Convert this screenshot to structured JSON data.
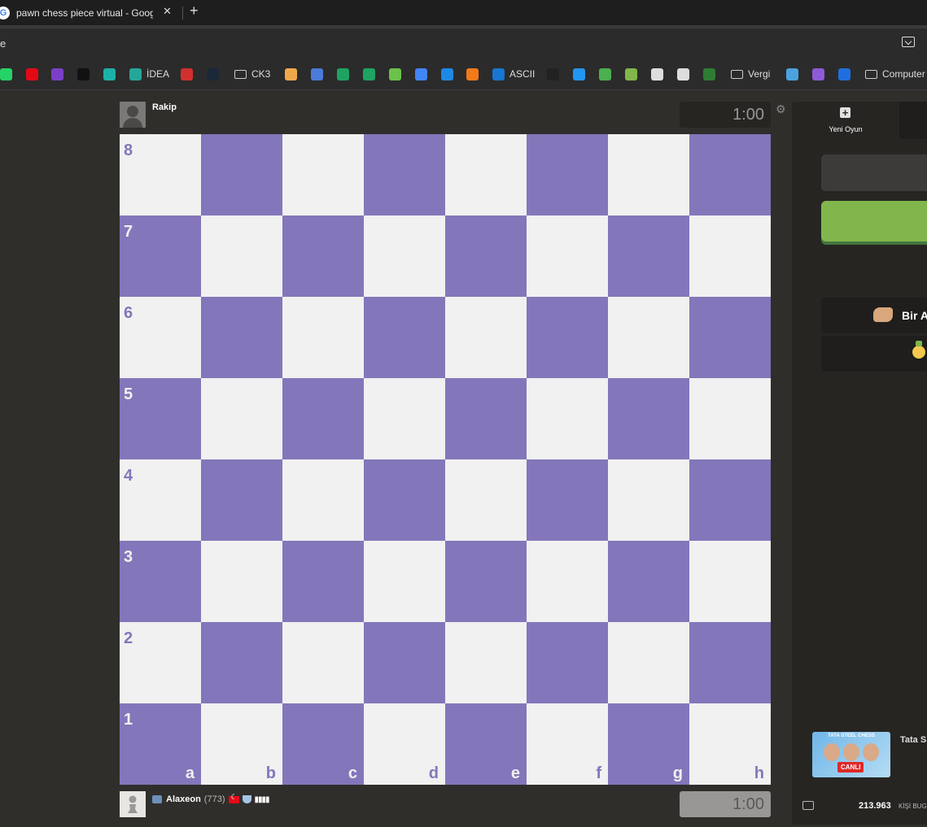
{
  "browser": {
    "tab_title": "pawn chess piece virtual - Goog",
    "tab_favicon": "G",
    "tab_close": "✕",
    "new_tab": "+",
    "address_text": "e"
  },
  "bookmarks": [
    {
      "icon": "whatsapp-icon",
      "color": "#25d366",
      "label": ""
    },
    {
      "icon": "netflix-icon",
      "color": "#e50914",
      "label": ""
    },
    {
      "icon": "bolt-icon",
      "color": "#7b3fc7",
      "label": ""
    },
    {
      "icon": "map-pin-icon",
      "color": "#111111",
      "label": ""
    },
    {
      "icon": "spiral-icon",
      "color": "#1bb1a8",
      "label": ""
    },
    {
      "icon": "idea-icon",
      "color": "#26a69a",
      "label": "İDEA"
    },
    {
      "icon": "chevron-up-icon",
      "color": "#d32f2f",
      "label": ""
    },
    {
      "icon": "steam-icon",
      "color": "#1b2838",
      "label": ""
    },
    {
      "icon": "folder-icon",
      "color": "",
      "label": "CK3"
    },
    {
      "icon": "x-emblem-icon",
      "color": "#f0a94a",
      "label": ""
    },
    {
      "icon": "x-emblem-icon",
      "color": "#4a7bd8",
      "label": ""
    },
    {
      "icon": "plus-green-icon",
      "color": "#1ea362",
      "label": ""
    },
    {
      "icon": "plus-green-icon",
      "color": "#1ea362",
      "label": ""
    },
    {
      "icon": "power-icon",
      "color": "#6cc24a",
      "label": ""
    },
    {
      "icon": "translate-icon",
      "color": "#4285f4",
      "label": ""
    },
    {
      "icon": "ih-icon",
      "color": "#1e88e5",
      "label": ""
    },
    {
      "icon": "hb-icon",
      "color": "#f27a1a",
      "label": ""
    },
    {
      "icon": "play-icon",
      "color": "#1976d2",
      "label": "ASCII"
    },
    {
      "icon": "speedometer-icon",
      "color": "#222222",
      "label": ""
    },
    {
      "icon": "crown-icon",
      "color": "#2196f3",
      "label": ""
    },
    {
      "icon": "alien-icon",
      "color": "#4caf50",
      "label": ""
    },
    {
      "icon": "pawn-icon",
      "color": "#81b64c",
      "label": ""
    },
    {
      "icon": "spider-icon",
      "color": "#dddddd",
      "label": ""
    },
    {
      "icon": "openai-icon",
      "color": "#dddddd",
      "label": ""
    },
    {
      "icon": "robot-icon",
      "color": "#2e7d32",
      "label": ""
    },
    {
      "icon": "folder-icon",
      "color": "",
      "label": "Vergi"
    },
    {
      "icon": "building-icon",
      "color": "#4aa3df",
      "label": ""
    },
    {
      "icon": "clapper-icon",
      "color": "#8e5bd6",
      "label": ""
    },
    {
      "icon": "f-icon",
      "color": "#1f6fe0",
      "label": ""
    },
    {
      "icon": "folder-icon",
      "color": "",
      "label": "Computer"
    }
  ],
  "game": {
    "opponent_name": "Rakip",
    "opponent_clock": "1:00",
    "player_name": "Alaxeon",
    "player_rating": "(773)",
    "player_bars": "▮▮▮▮",
    "player_clock": "1:00",
    "light_square_color": "#f0f1f0",
    "dark_square_color": "#8476ba"
  },
  "board": {
    "ranks": [
      "8",
      "7",
      "6",
      "5",
      "4",
      "3",
      "2",
      "1"
    ],
    "files": [
      "a",
      "b",
      "c",
      "d",
      "e",
      "f",
      "g",
      "h"
    ]
  },
  "panel": {
    "new_game_label": "Yeni Oyun",
    "menu_item_1": "Bir A",
    "promo_header": "TATA STEEL CHESS",
    "promo_live": "CANLI",
    "promo_title": "Tata S",
    "online_count": "213.963",
    "online_label": "KİŞİ BUG"
  }
}
